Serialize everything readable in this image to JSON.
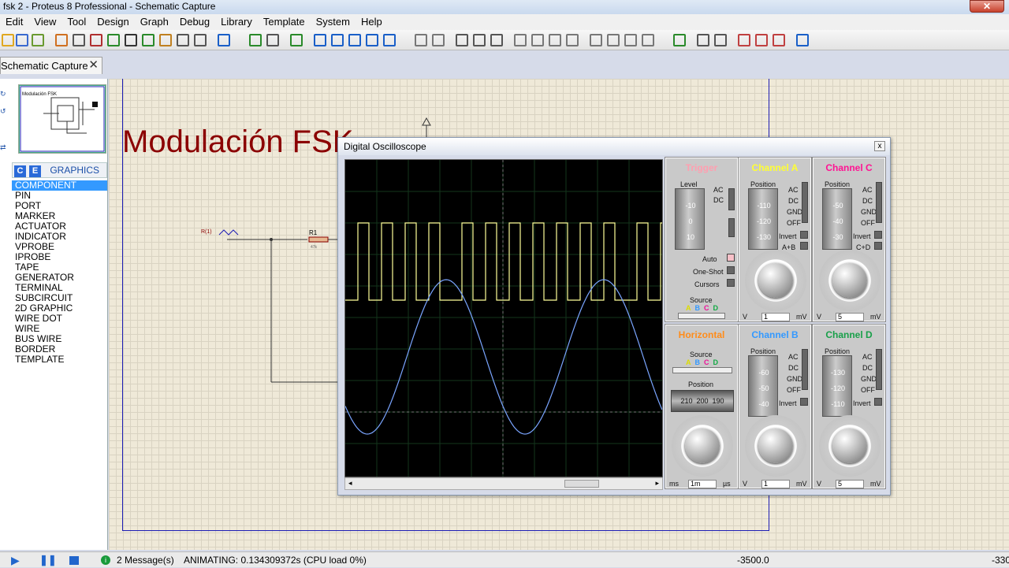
{
  "window": {
    "title": "fsk 2 - Proteus 8 Professional - Schematic Capture"
  },
  "menu": [
    "Edit",
    "View",
    "Tool",
    "Design",
    "Graph",
    "Debug",
    "Library",
    "Template",
    "System",
    "Help"
  ],
  "tab": {
    "label": "Schematic Capture",
    "close": "✕"
  },
  "graphics": {
    "header": "GRAPHICS",
    "c_label": "C",
    "e_label": "E",
    "items": [
      "COMPONENT",
      "PIN",
      "PORT",
      "MARKER",
      "ACTUATOR",
      "INDICATOR",
      "VPROBE",
      "IPROBE",
      "TAPE",
      "GENERATOR",
      "TERMINAL",
      "SUBCIRCUIT",
      "2D GRAPHIC",
      "WIRE DOT",
      "WIRE",
      "BUS WIRE",
      "BORDER",
      "TEMPLATE"
    ],
    "selected": 0
  },
  "schematic": {
    "title": "Modulación FSK",
    "r1_label": "R1",
    "r1_value": "47k",
    "source_label": "R(1)",
    "overview_title": "Modulación FSK"
  },
  "scope": {
    "title": "Digital Oscilloscope",
    "close": "x",
    "trigger": {
      "title": "Trigger",
      "level": "Level",
      "ac": "AC",
      "dc": "DC",
      "auto": "Auto",
      "oneshot": "One-Shot",
      "cursors": "Cursors",
      "source": "Source",
      "sources": [
        "A",
        "B",
        "C",
        "D"
      ],
      "ticks": [
        "-10",
        "0",
        "10"
      ]
    },
    "channel_a": {
      "title": "Channel A",
      "position": "Position",
      "ticks": [
        "-110",
        "-120",
        "-130"
      ],
      "opts": [
        "AC",
        "DC",
        "GND",
        "OFF"
      ],
      "invert": "Invert",
      "extra": "A+B",
      "value": "1",
      "unit_l": "V",
      "unit_r": "mV"
    },
    "channel_c": {
      "title": "Channel C",
      "position": "Position",
      "ticks": [
        "-50",
        "-40",
        "-30"
      ],
      "opts": [
        "AC",
        "DC",
        "GND",
        "OFF"
      ],
      "invert": "Invert",
      "extra": "C+D",
      "value": "5",
      "unit_l": "V",
      "unit_r": "mV"
    },
    "horizontal": {
      "title": "Horizontal",
      "source": "Source",
      "position": "Position",
      "pos_ticks": [
        "210",
        "200",
        "190"
      ],
      "value": "1m",
      "unit_l": "ms",
      "unit_r": "µs"
    },
    "channel_b": {
      "title": "Channel B",
      "position": "Position",
      "ticks": [
        "-60",
        "-50",
        "-40"
      ],
      "opts": [
        "AC",
        "DC",
        "GND",
        "OFF"
      ],
      "invert": "Invert",
      "value": "1",
      "unit_l": "V",
      "unit_r": "mV"
    },
    "channel_d": {
      "title": "Channel D",
      "position": "Position",
      "ticks": [
        "-130",
        "-120",
        "-110"
      ],
      "opts": [
        "AC",
        "DC",
        "GND",
        "OFF"
      ],
      "invert": "Invert",
      "value": "5",
      "unit_l": "V",
      "unit_r": "mV"
    },
    "colors": {
      "trigger": "#ff9fb0",
      "a": "#ffff33",
      "b": "#3399ff",
      "c": "#ff1493",
      "d": "#19a04a",
      "horizontal": "#ff8c1a",
      "trace_a": "#ffff99",
      "trace_b": "#7aa5ff"
    }
  },
  "status": {
    "messages": "2 Message(s)",
    "animating": "ANIMATING: 0.134309372s (CPU load 0%)",
    "coord_x": "-3500.0",
    "coord_y": "-330"
  }
}
